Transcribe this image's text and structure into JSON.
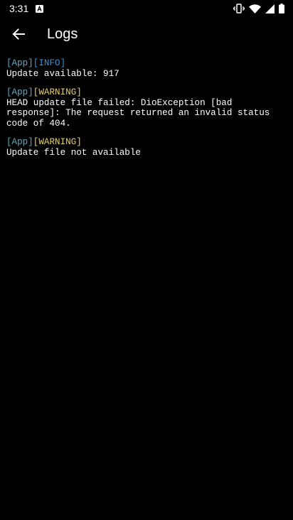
{
  "status_bar": {
    "time": "3:31",
    "icons": [
      "notification-a-icon",
      "vibrate-icon",
      "wifi-icon",
      "cell-signal-icon",
      "battery-icon"
    ]
  },
  "app_bar": {
    "back_icon": "arrow-left-icon",
    "title": "Logs"
  },
  "colors": {
    "background": "#000000",
    "text": "#ffffff",
    "app_tag": "#5aa9c6",
    "info_tag": "#3d8fd6",
    "warning_tag": "#e4cf6b"
  },
  "logs": [
    {
      "source": "[App]",
      "level": "[INFO]",
      "message": "Update available: 917"
    },
    {
      "source": "[App]",
      "level": "[WARNING]",
      "message": "HEAD update file failed: DioException [bad response]: The request returned an invalid status code of 404."
    },
    {
      "source": "[App]",
      "level": "[WARNING]",
      "message": "Update file not available"
    }
  ]
}
